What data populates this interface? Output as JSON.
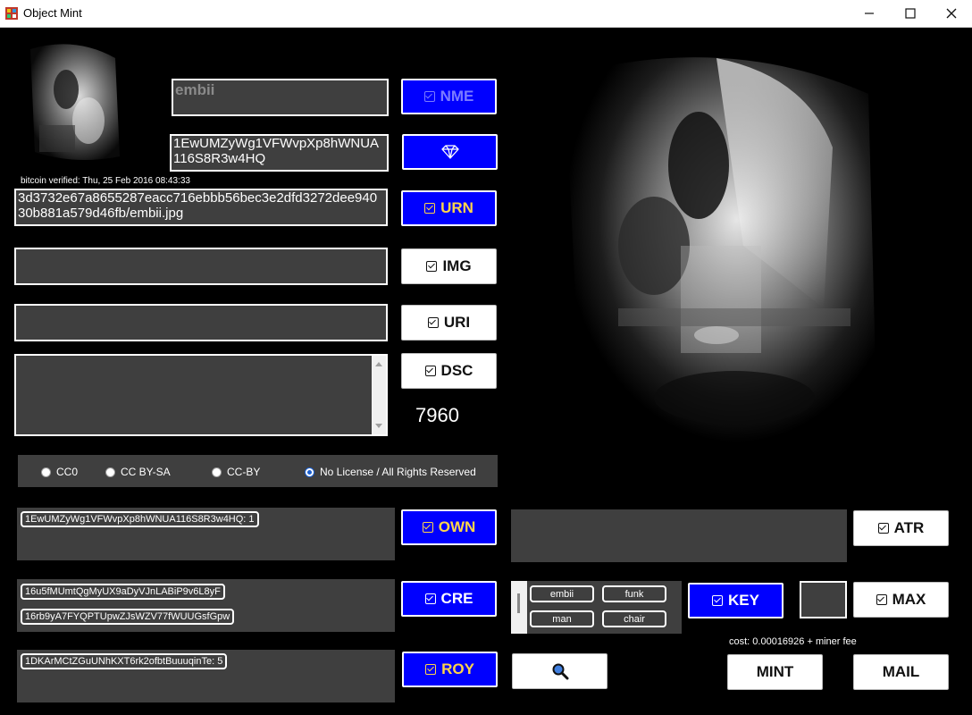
{
  "window": {
    "title": "Object Mint"
  },
  "name": {
    "value": "embii",
    "button": "NME"
  },
  "address": {
    "value": "1EwUMZyWg1VFWvpXp8hWNUA116S8R3w4HQ",
    "verified": "bitcoin verified: Thu, 25 Feb 2016 08:43:33"
  },
  "urn": {
    "value": "3d3732e67a8655287eacc716ebbb56bec3e2dfd3272dee94030b881a579d46fb/embii.jpg",
    "button": "URN"
  },
  "img": {
    "value": "",
    "button": "IMG"
  },
  "uri": {
    "value": "",
    "button": "URI"
  },
  "dsc": {
    "value": "",
    "button": "DSC",
    "count": "7960"
  },
  "license": {
    "options": [
      "CC0",
      "CC BY-SA",
      "CC-BY",
      "No License / All Rights Reserved"
    ],
    "selected": "No License / All Rights Reserved"
  },
  "owners": {
    "items": [
      "1EwUMZyWg1VFWvpXp8hWNUA116S8R3w4HQ: 1"
    ],
    "button": "OWN"
  },
  "creators": {
    "items": [
      "16u5fMUmtQgMyUX9aDyVJnLABiP9v6L8yF",
      "16rb9yA7FYQPTUpwZJsWZV77fWUUGsfGpw"
    ],
    "button": "CRE"
  },
  "royalties": {
    "items": [
      "1DKArMCtZGuUNhKXT6rk2ofbtBuuuqinTe: 5"
    ],
    "button": "ROY"
  },
  "attributes": {
    "button": "ATR"
  },
  "keywords": {
    "items": [
      "embii",
      "funk",
      "man",
      "chair"
    ],
    "button": "KEY"
  },
  "max": {
    "value": "",
    "button": "MAX"
  },
  "cost": {
    "text": "cost: 0.00016926  + miner fee"
  },
  "actions": {
    "mint": "MINT",
    "mail": "MAIL"
  },
  "icons": {
    "diamond": "diamond-icon",
    "search": "magnifier-icon",
    "checkbox": "checked-box-icon"
  },
  "colors": {
    "accent_blue": "#0000ff",
    "panel": "#3f3f3f",
    "background": "#000000",
    "name_button_text": "#7b7bff",
    "own_button_text": "#ffd54a"
  }
}
